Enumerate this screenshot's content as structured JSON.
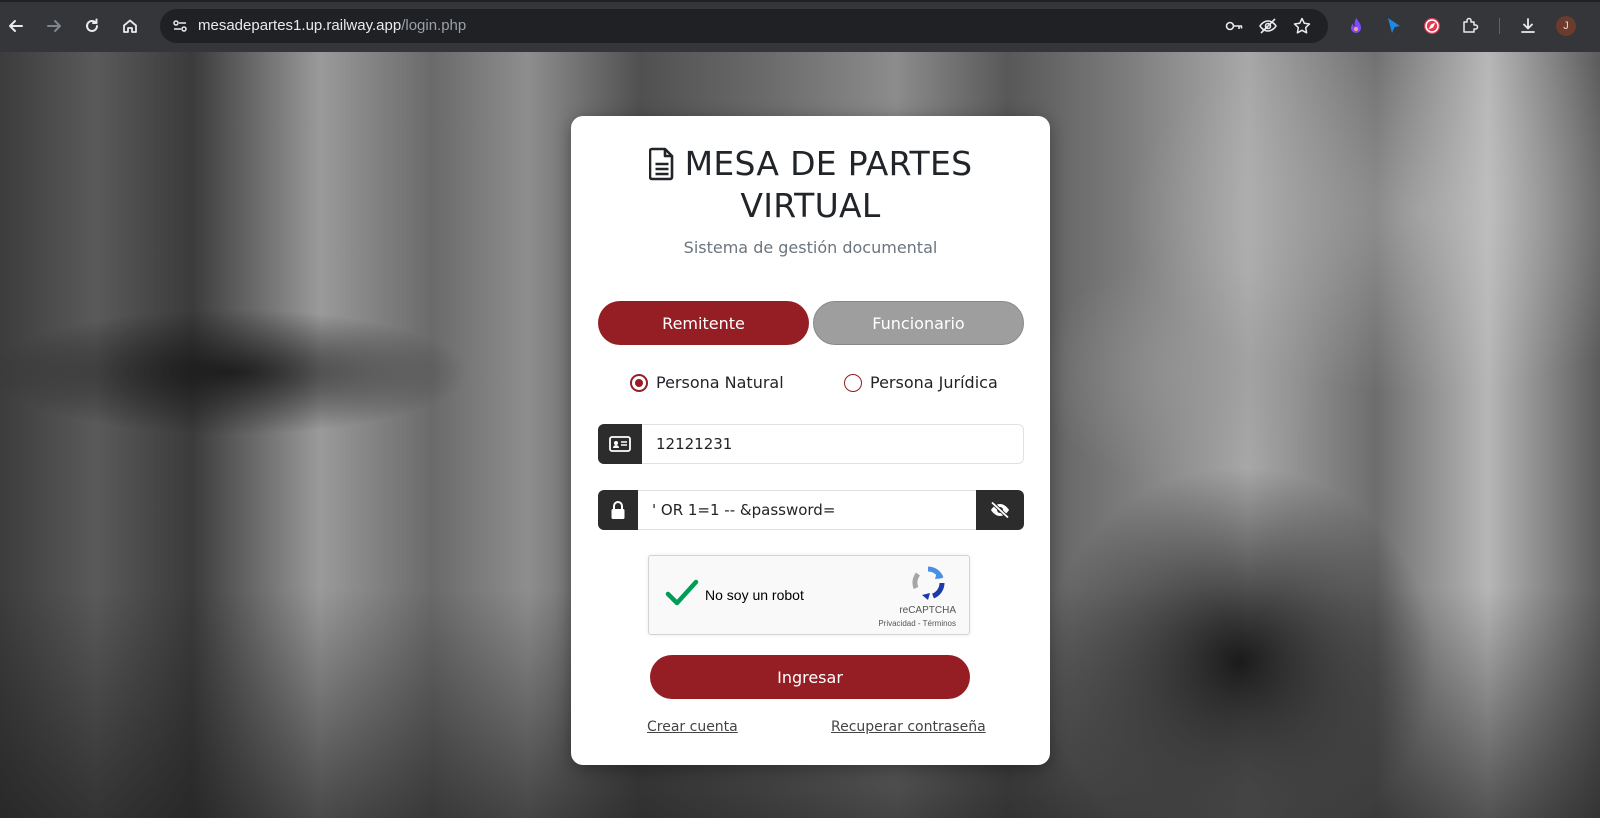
{
  "browser": {
    "url_host": "mesadepartes1.up.railway.app",
    "url_path": "/login.php",
    "profile_initial": "J",
    "icons": [
      "back-icon",
      "forward-icon",
      "reload-icon",
      "home-icon",
      "site-info-icon",
      "password-key-icon",
      "tracking-eye-off-icon",
      "bookmark-star-icon",
      "extension-flame-icon",
      "extension-cursor-icon",
      "extension-compass-icon",
      "extensions-puzzle-icon",
      "downloads-icon"
    ]
  },
  "login": {
    "title_line1": "MESA DE PARTES",
    "title_line2": "VIRTUAL",
    "subtitle": "Sistema de gestión documental",
    "tabs": [
      "Remitente",
      "Funcionario"
    ],
    "active_tab": "Remitente",
    "person_types": [
      "Persona Natural",
      "Persona Jurídica"
    ],
    "selected_person_type": "Persona Natural",
    "document_value": "12121231",
    "password_value": "' OR 1=1 -- &password=",
    "recaptcha": {
      "label": "No soy un robot",
      "brand": "reCAPTCHA",
      "privacy": "Privacidad",
      "terms": "Términos",
      "checked": true
    },
    "submit_label": "Ingresar",
    "link_create": "Crear cuenta",
    "link_recover": "Recuperar contraseña"
  },
  "colors": {
    "accent": "#951e24",
    "secondary_tab": "#9e9e9e",
    "addon": "#2c2c2c",
    "chrome": "#35363a",
    "omnibox": "#202124"
  }
}
